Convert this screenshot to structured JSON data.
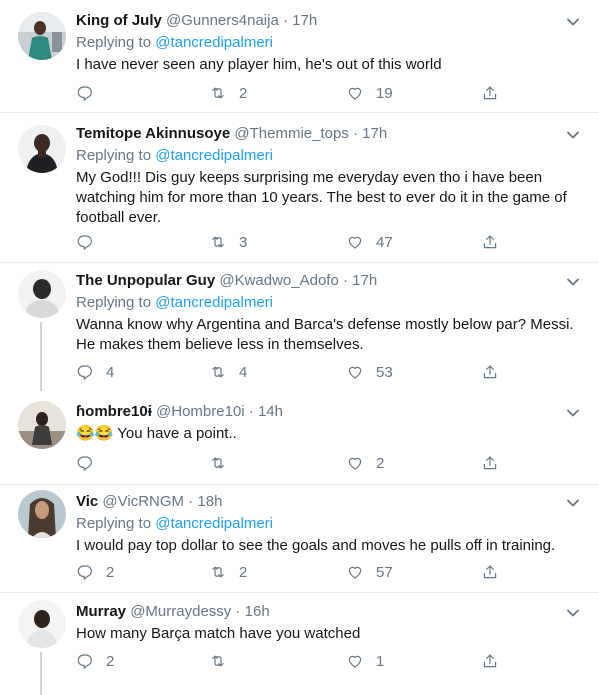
{
  "tweets": [
    {
      "name": "King of July",
      "handle": "@Gunners4naija",
      "time": "17h",
      "replying_prefix": "Replying to",
      "replying_to": "@tancredipalmeri",
      "text": "I have never seen any player him, he's out of this world",
      "replies": "",
      "retweets": "2",
      "likes": "19"
    },
    {
      "name": "Temitope Akinnusoye",
      "handle": "@Themmie_tops",
      "time": "17h",
      "replying_prefix": "Replying to",
      "replying_to": "@tancredipalmeri",
      "text": "My God!!! Dis guy keeps surprising me everyday even tho i have been watching him for more than 10 years. The best to ever do it in the game of football ever.",
      "replies": "",
      "retweets": "3",
      "likes": "47"
    },
    {
      "name": "The Unpopular Guy",
      "handle": "@Kwadwo_Adofo",
      "time": "17h",
      "replying_prefix": "Replying to",
      "replying_to": "@tancredipalmeri",
      "text": "Wanna know why Argentina and Barca's defense mostly below par? Messi. He makes them believe less in themselves.",
      "replies": "4",
      "retweets": "4",
      "likes": "53"
    },
    {
      "name": "ɦombre10ɨ",
      "handle": "@Hombre10i",
      "time": "14h",
      "emoji": "😂😂",
      "text": "You have a point..",
      "replies": "",
      "retweets": "",
      "likes": "2"
    },
    {
      "name": "Vic",
      "handle": "@VicRNGM",
      "time": "18h",
      "replying_prefix": "Replying to",
      "replying_to": "@tancredipalmeri",
      "text": "I would pay top dollar to see the goals and moves he pulls off in training.",
      "replies": "2",
      "retweets": "2",
      "likes": "57"
    },
    {
      "name": "Murray",
      "handle": "@Murraydessy",
      "time": "16h",
      "text": "How many Barça match have you watched",
      "replies": "2",
      "retweets": "",
      "likes": "1"
    }
  ],
  "separator": "·",
  "icons": [
    "reply-icon",
    "retweet-icon",
    "like-icon",
    "share-icon",
    "more-caret-icon"
  ],
  "colors": {
    "link": "#1da1f2",
    "secondary": "#657786",
    "divider": "#e6ecf0",
    "thread_line": "#ccd6dd"
  }
}
